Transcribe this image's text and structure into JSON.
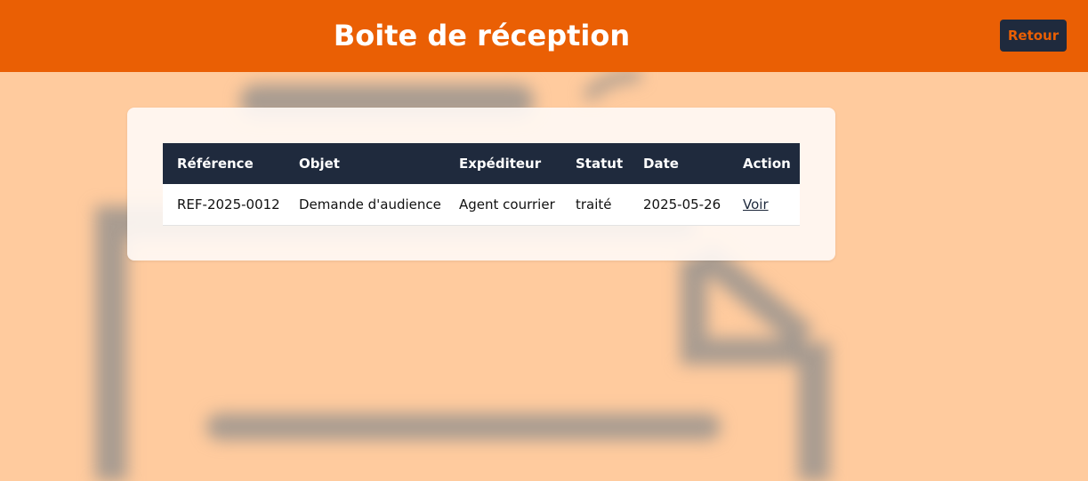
{
  "header": {
    "title": "Boite de réception",
    "back_label": "Retour"
  },
  "table": {
    "columns": [
      "Référence",
      "Objet",
      "Expéditeur",
      "Statut",
      "Date",
      "Action"
    ],
    "rows": [
      {
        "reference": "REF-2025-0012",
        "objet": "Demande d'audience",
        "expediteur": "Agent courrier",
        "statut": "traité",
        "date": "2025-05-26",
        "action": "Voir"
      }
    ]
  },
  "colors": {
    "header_bg": "#ea5f04",
    "page_bg": "#ffcb9e",
    "table_header_bg": "#1f2a3d",
    "button_bg": "#1f2a3d",
    "button_text": "#ea5f04"
  },
  "icons": {
    "background": "document-illustration"
  }
}
